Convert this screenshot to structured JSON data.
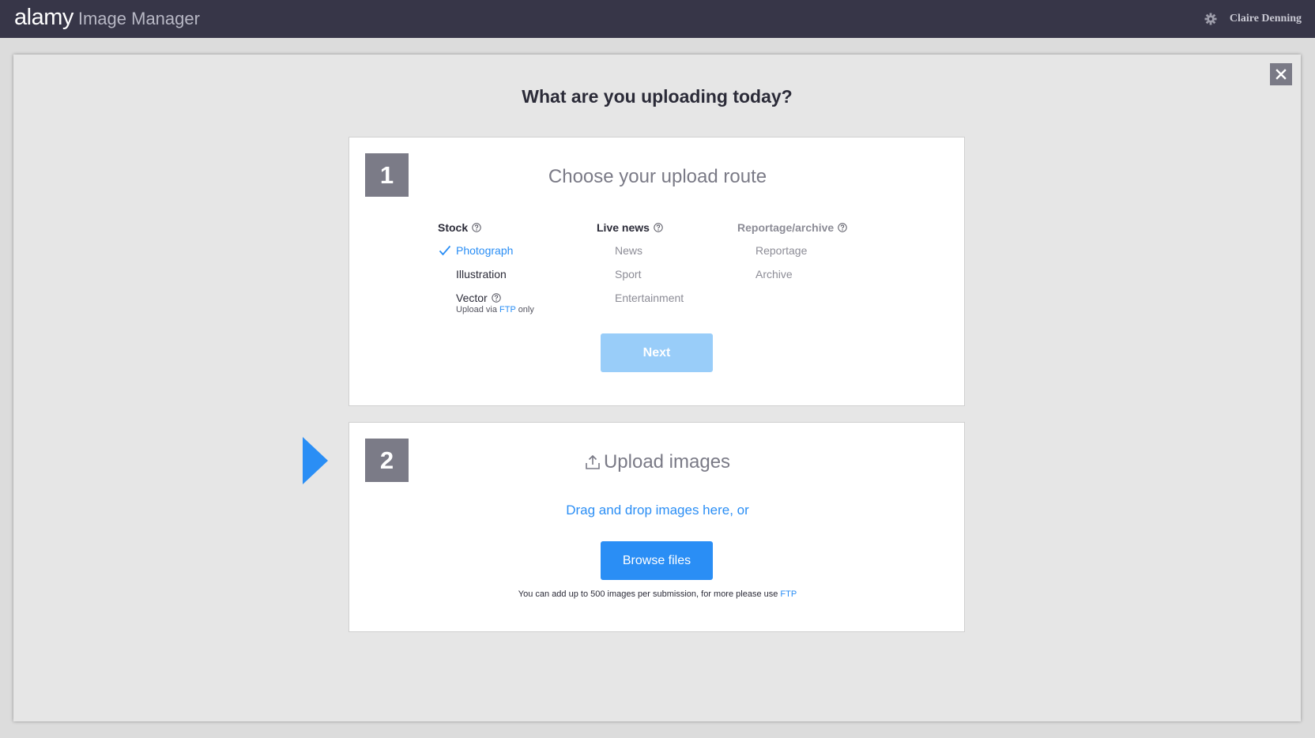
{
  "header": {
    "logo": "alamy",
    "product": "Image Manager",
    "user_name": "Claire Denning",
    "settings_icon": "gear-icon"
  },
  "modal": {
    "title": "What are you uploading today?",
    "close_icon": "close-icon"
  },
  "step1": {
    "number": "1",
    "title": "Choose your upload route",
    "columns": {
      "stock": {
        "heading": "Stock",
        "options": [
          "Photograph",
          "Illustration",
          "Vector"
        ],
        "selected": "Photograph",
        "vector_note_prefix": "Upload via",
        "vector_note_link": "FTP",
        "vector_note_suffix": "only"
      },
      "live_news": {
        "heading": "Live news",
        "options": [
          "News",
          "Sport",
          "Entertainment"
        ]
      },
      "reportage": {
        "heading": "Reportage/archive",
        "options": [
          "Reportage",
          "Archive"
        ]
      }
    },
    "next_label": "Next"
  },
  "step2": {
    "number": "2",
    "title": "Upload images",
    "drag_text": "Drag and drop images here, or",
    "browse_label": "Browse files",
    "limit_note": "You can add up to 500 images per submission, for more please use",
    "limit_link": "FTP"
  },
  "colors": {
    "accent": "#2a8ef5",
    "header_bg": "#373648",
    "step_badge": "#7b7b87",
    "next_disabled": "#99cdf9"
  }
}
